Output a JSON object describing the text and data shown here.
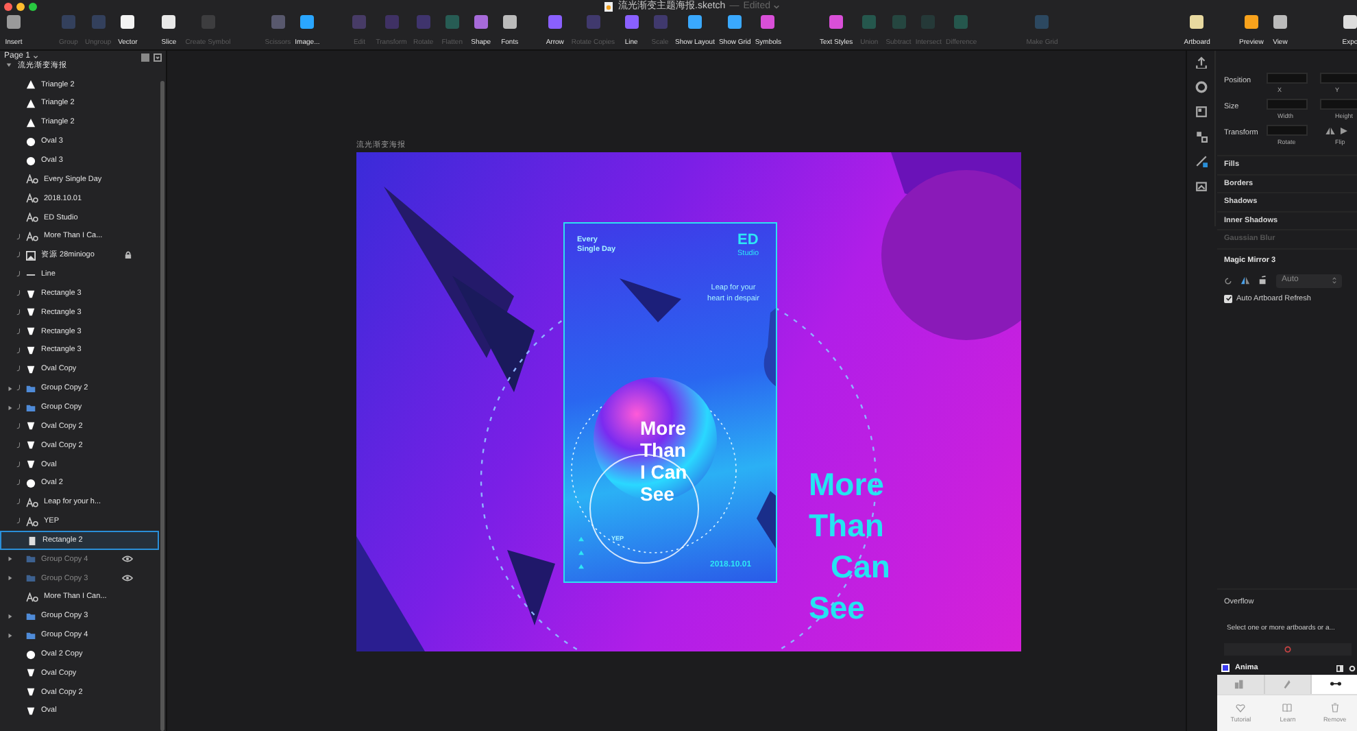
{
  "window": {
    "title": "流光渐变主题海报.sketch",
    "separator": "—",
    "status": "Edited"
  },
  "toolbar": {
    "groups": [
      [
        {
          "label": "Insert",
          "disabled": false
        }
      ],
      [
        {
          "label": "Group",
          "disabled": true
        },
        {
          "label": "Ungroup",
          "disabled": true
        },
        {
          "label": "Vector",
          "disabled": false
        }
      ],
      [
        {
          "label": "Slice",
          "disabled": false
        },
        {
          "label": "Create Symbol",
          "disabled": true
        }
      ],
      [
        {
          "label": "Scissors",
          "disabled": true
        },
        {
          "label": "Image...",
          "disabled": false
        }
      ],
      [
        {
          "label": "Edit",
          "disabled": true
        },
        {
          "label": "Transform",
          "disabled": true
        },
        {
          "label": "Rotate",
          "disabled": true
        },
        {
          "label": "Flatten",
          "disabled": true
        },
        {
          "label": "Shape",
          "disabled": false
        },
        {
          "label": "Fonts",
          "disabled": false
        }
      ],
      [
        {
          "label": "Arrow",
          "disabled": false
        },
        {
          "label": "Rotate Copies",
          "disabled": true
        },
        {
          "label": "Line",
          "disabled": false
        },
        {
          "label": "Scale",
          "disabled": true
        }
      ],
      [
        {
          "label": "Show Layout",
          "disabled": false
        },
        {
          "label": "Show Grid",
          "disabled": false
        },
        {
          "label": "Symbols",
          "disabled": false
        }
      ],
      [
        {
          "label": "Text Styles",
          "disabled": false
        },
        {
          "label": "Union",
          "disabled": true
        },
        {
          "label": "Subtract",
          "disabled": true
        },
        {
          "label": "Intersect",
          "disabled": true
        },
        {
          "label": "Difference",
          "disabled": true
        }
      ],
      [
        {
          "label": "Make Grid",
          "disabled": true
        }
      ],
      [
        {
          "label": "Artboard",
          "disabled": false
        }
      ],
      [
        {
          "label": "Preview",
          "disabled": false
        },
        {
          "label": "View",
          "disabled": false
        }
      ],
      [
        {
          "label": "Expo",
          "disabled": false
        }
      ]
    ]
  },
  "layers_panel": {
    "page": "Page 1",
    "layers": [
      {
        "name": "流光渐变海报",
        "kind": "artboard",
        "expanded": true,
        "children": [
          {
            "name": "Triangle 2",
            "kind": "triangle",
            "expanded": false,
            "masked": false,
            "locked": false,
            "hidden": false,
            "selected": false
          },
          {
            "name": "Triangle 2",
            "kind": "triangle",
            "expanded": false,
            "masked": false,
            "locked": false,
            "hidden": false,
            "selected": false
          },
          {
            "name": "Triangle 2",
            "kind": "triangle",
            "expanded": false,
            "masked": false,
            "locked": false,
            "hidden": false,
            "selected": false
          },
          {
            "name": "Oval 3",
            "kind": "oval",
            "expanded": false,
            "masked": false,
            "locked": false,
            "hidden": false,
            "selected": false
          },
          {
            "name": "Oval 3",
            "kind": "oval",
            "expanded": false,
            "masked": false,
            "locked": false,
            "hidden": false,
            "selected": false
          },
          {
            "name": "Every Single Day",
            "kind": "text",
            "expanded": false,
            "masked": false,
            "locked": false,
            "hidden": false,
            "selected": false
          },
          {
            "name": "2018.10.01",
            "kind": "text",
            "expanded": false,
            "masked": false,
            "locked": false,
            "hidden": false,
            "selected": false
          },
          {
            "name": "ED Studio",
            "kind": "text",
            "expanded": false,
            "masked": false,
            "locked": false,
            "hidden": false,
            "selected": false
          },
          {
            "name": "More Than I Ca...",
            "kind": "text",
            "expanded": false,
            "masked": true,
            "locked": false,
            "hidden": false,
            "selected": false
          },
          {
            "name": "资源 28miniogo",
            "kind": "image",
            "expanded": false,
            "masked": true,
            "locked": true,
            "hidden": false,
            "selected": false
          },
          {
            "name": "Line",
            "kind": "line",
            "expanded": false,
            "masked": true,
            "locked": false,
            "hidden": false,
            "selected": false
          },
          {
            "name": "Rectangle 3",
            "kind": "shape",
            "expanded": false,
            "masked": true,
            "locked": false,
            "hidden": false,
            "selected": false
          },
          {
            "name": "Rectangle 3",
            "kind": "shape",
            "expanded": false,
            "masked": true,
            "locked": false,
            "hidden": false,
            "selected": false
          },
          {
            "name": "Rectangle 3",
            "kind": "shape",
            "expanded": false,
            "masked": true,
            "locked": false,
            "hidden": false,
            "selected": false
          },
          {
            "name": "Rectangle 3",
            "kind": "shape",
            "expanded": false,
            "masked": true,
            "locked": false,
            "hidden": false,
            "selected": false
          },
          {
            "name": "Oval Copy",
            "kind": "shape",
            "expanded": false,
            "masked": true,
            "locked": false,
            "hidden": false,
            "selected": false
          },
          {
            "name": "Group Copy 2",
            "kind": "group",
            "expanded": false,
            "masked": true,
            "locked": false,
            "hidden": false,
            "selected": false
          },
          {
            "name": "Group Copy",
            "kind": "group",
            "expanded": false,
            "masked": true,
            "locked": false,
            "hidden": false,
            "selected": false
          },
          {
            "name": "Oval Copy 2",
            "kind": "shape",
            "expanded": false,
            "masked": true,
            "locked": false,
            "hidden": false,
            "selected": false
          },
          {
            "name": "Oval Copy 2",
            "kind": "shape",
            "expanded": false,
            "masked": true,
            "locked": false,
            "hidden": false,
            "selected": false
          },
          {
            "name": "Oval",
            "kind": "shape",
            "expanded": false,
            "masked": true,
            "locked": false,
            "hidden": false,
            "selected": false
          },
          {
            "name": "Oval 2",
            "kind": "oval",
            "expanded": false,
            "masked": true,
            "locked": false,
            "hidden": false,
            "selected": false
          },
          {
            "name": "Leap for your h...",
            "kind": "text",
            "expanded": false,
            "masked": true,
            "locked": false,
            "hidden": false,
            "selected": false
          },
          {
            "name": "YEP",
            "kind": "text",
            "expanded": false,
            "masked": true,
            "locked": false,
            "hidden": false,
            "selected": false
          },
          {
            "name": "Rectangle 2",
            "kind": "rect",
            "expanded": false,
            "masked": false,
            "locked": false,
            "hidden": false,
            "selected": true
          },
          {
            "name": "Group Copy 4",
            "kind": "group",
            "expanded": false,
            "masked": false,
            "locked": false,
            "hidden": true,
            "selected": false
          },
          {
            "name": "Group Copy 3",
            "kind": "group",
            "expanded": false,
            "masked": false,
            "locked": false,
            "hidden": true,
            "selected": false
          },
          {
            "name": "More Than I Can...",
            "kind": "text",
            "expanded": false,
            "masked": false,
            "locked": false,
            "hidden": false,
            "selected": false
          },
          {
            "name": "Group Copy 3",
            "kind": "group",
            "expanded": false,
            "masked": false,
            "locked": false,
            "hidden": false,
            "selected": false
          },
          {
            "name": "Group Copy 4",
            "kind": "group",
            "expanded": false,
            "masked": false,
            "locked": false,
            "hidden": false,
            "selected": false
          },
          {
            "name": "Oval 2 Copy",
            "kind": "oval",
            "expanded": false,
            "masked": false,
            "locked": false,
            "hidden": false,
            "selected": false
          },
          {
            "name": "Oval Copy",
            "kind": "shape",
            "expanded": false,
            "masked": false,
            "locked": false,
            "hidden": false,
            "selected": false
          },
          {
            "name": "Oval Copy 2",
            "kind": "shape",
            "expanded": false,
            "masked": false,
            "locked": false,
            "hidden": false,
            "selected": false
          },
          {
            "name": "Oval",
            "kind": "shape",
            "expanded": false,
            "masked": false,
            "locked": false,
            "hidden": false,
            "selected": false
          }
        ]
      }
    ]
  },
  "canvas": {
    "artboard_title": "流光渐变海报",
    "poster": {
      "tagline": "Every Single Day",
      "studio_mark": "ED",
      "studio_name": "Studio",
      "caption": "Leap for your heart in despair",
      "title_lines": [
        "More",
        "Than",
        "I Can",
        "See"
      ],
      "label": "YEP",
      "date": "2018.10.01"
    },
    "headline_lines": [
      "More",
      "Than",
      "Can",
      "See"
    ]
  },
  "inspector": {
    "position": {
      "label": "Position",
      "x_label": "X",
      "y_label": "Y"
    },
    "size": {
      "label": "Size",
      "width_label": "Width",
      "height_label": "Height"
    },
    "transform": {
      "label": "Transform",
      "rotate_label": "Rotate",
      "flip_label": "Flip"
    },
    "sections": [
      {
        "label": "Fills",
        "disabled": false
      },
      {
        "label": "Borders",
        "disabled": false
      },
      {
        "label": "Shadows",
        "disabled": false
      },
      {
        "label": "Inner Shadows",
        "disabled": false
      },
      {
        "label": "Gaussian Blur",
        "disabled": true
      }
    ],
    "plugin": {
      "title": "Magic Mirror 3",
      "mode": "Auto",
      "auto_refresh": {
        "label": "Auto Artboard Refresh",
        "checked": true
      }
    },
    "overflow": {
      "title": "Overflow",
      "message": "Select one or more artboards or a..."
    },
    "anima": {
      "title": "Anima",
      "tabs": [
        {
          "selected": false
        },
        {
          "selected": false
        },
        {
          "selected": true
        }
      ],
      "actions": [
        "Tutorial",
        "Learn",
        "Remove"
      ]
    }
  }
}
